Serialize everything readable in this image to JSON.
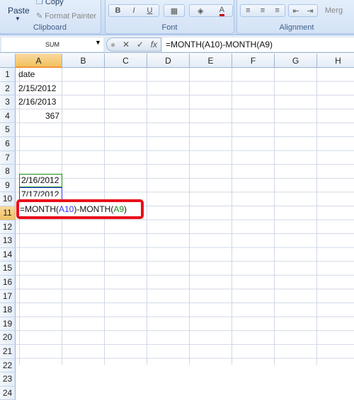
{
  "ribbon": {
    "clipboard": {
      "label": "Clipboard",
      "paste": "Paste",
      "copy": "Copy",
      "format_painter": "Format Painter"
    },
    "font": {
      "label": "Font",
      "bold": "B",
      "italic": "I",
      "underline": "U",
      "font_color": "A"
    },
    "alignment": {
      "label": "Alignment",
      "merge": "Merg"
    }
  },
  "formula_bar": {
    "name_box": "SUM",
    "formula": "=MONTH(A10)-MONTH(A9)",
    "fx": "fx",
    "cancel": "✕",
    "enter": "✓"
  },
  "columns": [
    "A",
    "B",
    "C",
    "D",
    "E",
    "F",
    "G",
    "H"
  ],
  "rows": [
    "1",
    "2",
    "3",
    "4",
    "5",
    "6",
    "7",
    "8",
    "9",
    "10",
    "11",
    "12",
    "13",
    "14",
    "15",
    "16",
    "17",
    "18",
    "19",
    "20",
    "21",
    "22",
    "23",
    "24"
  ],
  "cells": {
    "A1": "date",
    "A2": "2/15/2012",
    "A3": "2/16/2013",
    "A4": "367",
    "A9": "2/16/2012",
    "A10": "7/17/2012"
  },
  "editing": {
    "prefix": "=MONTH(",
    "ref1": "A10",
    "mid": ")-MONTH(",
    "ref2": "A9",
    "suffix": ")"
  },
  "colors": {
    "ref1": "#3333ff",
    "ref2": "#1a8a1a",
    "highlight": "#e8101a"
  }
}
